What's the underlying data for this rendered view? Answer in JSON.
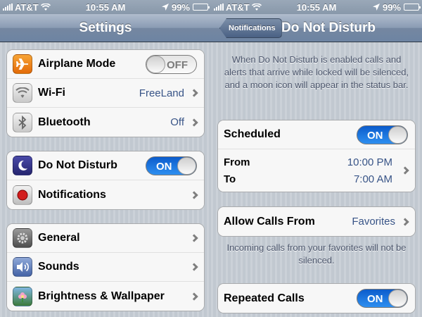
{
  "status_bar": {
    "carrier": "AT&T",
    "time": "10:55 AM",
    "battery": "99%",
    "battery_level": 0.99
  },
  "settings": {
    "title": "Settings",
    "groups": [
      [
        {
          "label": "Airplane Mode",
          "toggle": "OFF",
          "icon": "airplane-icon"
        },
        {
          "label": "Wi-Fi",
          "value": "FreeLand",
          "icon": "wifi-icon"
        },
        {
          "label": "Bluetooth",
          "value": "Off",
          "icon": "bluetooth-icon"
        }
      ],
      [
        {
          "label": "Do Not Disturb",
          "toggle": "ON",
          "icon": "moon-icon"
        },
        {
          "label": "Notifications",
          "icon": "notifications-icon"
        }
      ],
      [
        {
          "label": "General",
          "icon": "gear-icon"
        },
        {
          "label": "Sounds",
          "icon": "speaker-icon"
        },
        {
          "label": "Brightness & Wallpaper",
          "icon": "flower-icon"
        }
      ]
    ]
  },
  "dnd": {
    "back_label": "Notifications",
    "title": "Do Not Disturb",
    "description": "When Do Not Disturb is enabled calls and alerts that arrive while locked will be silenced, and a moon icon will appear in the status bar.",
    "scheduled_label": "Scheduled",
    "scheduled_toggle": "ON",
    "from_label": "From",
    "from_value": "10:00 PM",
    "to_label": "To",
    "to_value": "7:00 AM",
    "allow_calls_label": "Allow Calls From",
    "allow_calls_value": "Favorites",
    "allow_calls_note": "Incoming calls from your favorites will not be silenced.",
    "repeated_label": "Repeated Calls",
    "repeated_toggle": "ON"
  },
  "colors": {
    "toggle_on": "#1f77e0",
    "value_text": "#385487",
    "background": "#c5ccd4"
  }
}
